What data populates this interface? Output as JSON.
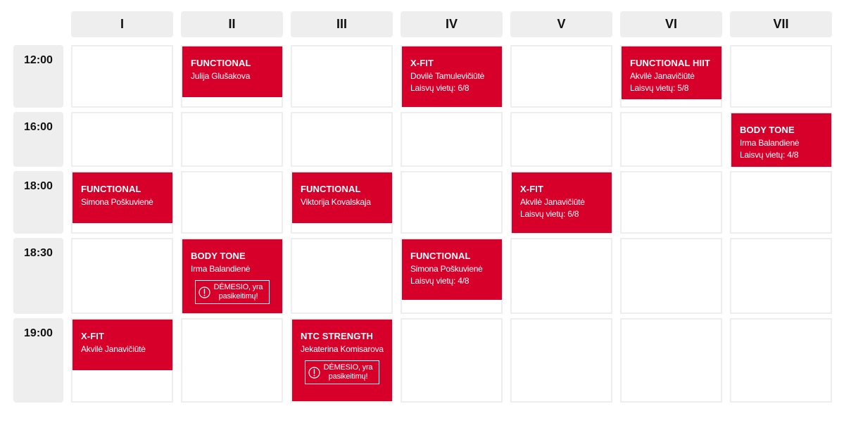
{
  "days": [
    "I",
    "II",
    "III",
    "IV",
    "V",
    "VI",
    "VII"
  ],
  "times": [
    "12:00",
    "16:00",
    "18:00",
    "18:30",
    "19:00"
  ],
  "accent_color": "#d7002a",
  "warning_text": "DĖMESIO, yra pasikeitimų!",
  "events": [
    {
      "day": 1,
      "time": 0,
      "name": "FUNCTIONAL",
      "trainer": "Julija Glušakova",
      "spots": "",
      "warning": false
    },
    {
      "day": 3,
      "time": 0,
      "name": "X-FIT",
      "trainer": "Dovilė Tamulevičiūtė",
      "spots": "Laisvų vietų: 6/8",
      "warning": false
    },
    {
      "day": 5,
      "time": 0,
      "name": "FUNCTIONAL HIIT",
      "trainer": "Akvilė Janavičiūtė",
      "spots": "Laisvų vietų: 5/8",
      "warning": false
    },
    {
      "day": 6,
      "time": 1,
      "name": "BODY TONE",
      "trainer": "Irma Balandienė",
      "spots": "Laisvų vietų: 4/8",
      "warning": false
    },
    {
      "day": 0,
      "time": 2,
      "name": "FUNCTIONAL",
      "trainer": "Simona Poškuvienė",
      "spots": "",
      "warning": false
    },
    {
      "day": 2,
      "time": 2,
      "name": "FUNCTIONAL",
      "trainer": "Viktorija Kovalskaja",
      "spots": "",
      "warning": false
    },
    {
      "day": 4,
      "time": 2,
      "name": "X-FIT",
      "trainer": "Akvilė Janavičiūtė",
      "spots": "Laisvų vietų: 6/8",
      "warning": false
    },
    {
      "day": 1,
      "time": 3,
      "name": "BODY TONE",
      "trainer": "Irma Balandienė",
      "spots": "",
      "warning": true
    },
    {
      "day": 3,
      "time": 3,
      "name": "FUNCTIONAL",
      "trainer": "Simona Poškuvienė",
      "spots": "Laisvų vietų: 4/8",
      "warning": false
    },
    {
      "day": 0,
      "time": 4,
      "name": "X-FIT",
      "trainer": "Akvilė Janavičiūtė",
      "spots": "",
      "warning": false
    },
    {
      "day": 2,
      "time": 4,
      "name": "NTC STRENGTH",
      "trainer": "Jekaterina Komisarova",
      "spots": "",
      "warning": true
    }
  ]
}
